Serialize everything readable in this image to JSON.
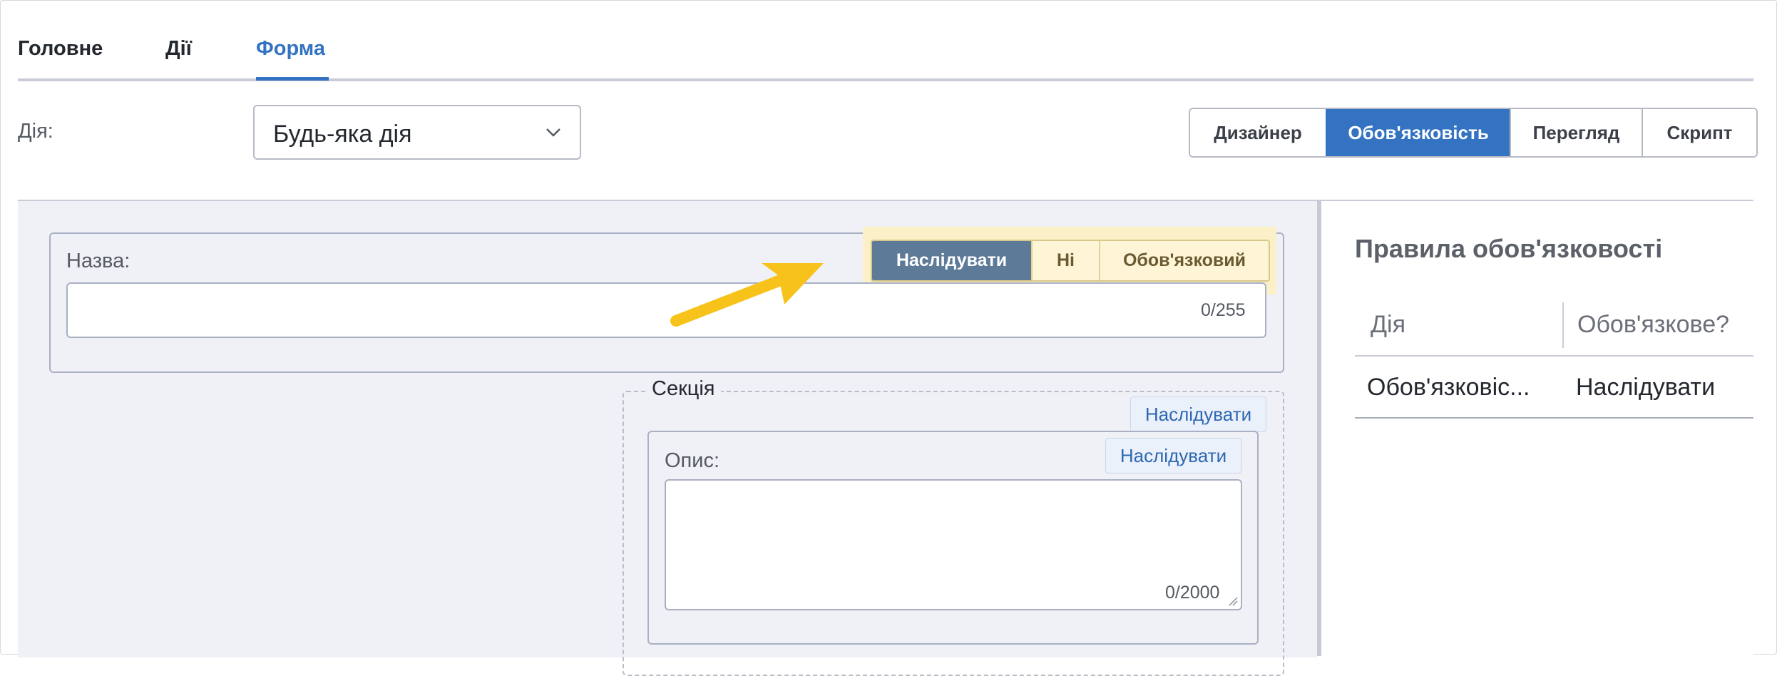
{
  "tabs": [
    {
      "label": "Головне"
    },
    {
      "label": "Дії"
    },
    {
      "label": "Форма"
    }
  ],
  "action": {
    "label": "Дія:",
    "selected": "Будь-яка дія"
  },
  "view_modes": [
    {
      "label": "Дизайнер"
    },
    {
      "label": "Обов'язковість"
    },
    {
      "label": "Перегляд"
    },
    {
      "label": "Скрипт"
    }
  ],
  "name_field": {
    "label": "Назва:",
    "counter": "0/255",
    "requirement_options": [
      {
        "label": "Наслідувати"
      },
      {
        "label": "Ні"
      },
      {
        "label": "Обов'язковий"
      }
    ]
  },
  "section": {
    "title": "Секція",
    "inherit_label": "Наслідувати"
  },
  "description_field": {
    "label": "Опис:",
    "inherit_label": "Наслідувати",
    "counter": "0/2000"
  },
  "rules_panel": {
    "title": "Правила обов'язковості",
    "columns": [
      "Дія",
      "Обов'язкове?"
    ],
    "rows": [
      {
        "action": "Обов'язковіс...",
        "required": "Наслідувати"
      }
    ]
  },
  "colors": {
    "accent": "#3473c1",
    "highlight": "#fbf0c7",
    "arrow": "#f7c21a",
    "active_requirement": "#5d7b99"
  }
}
